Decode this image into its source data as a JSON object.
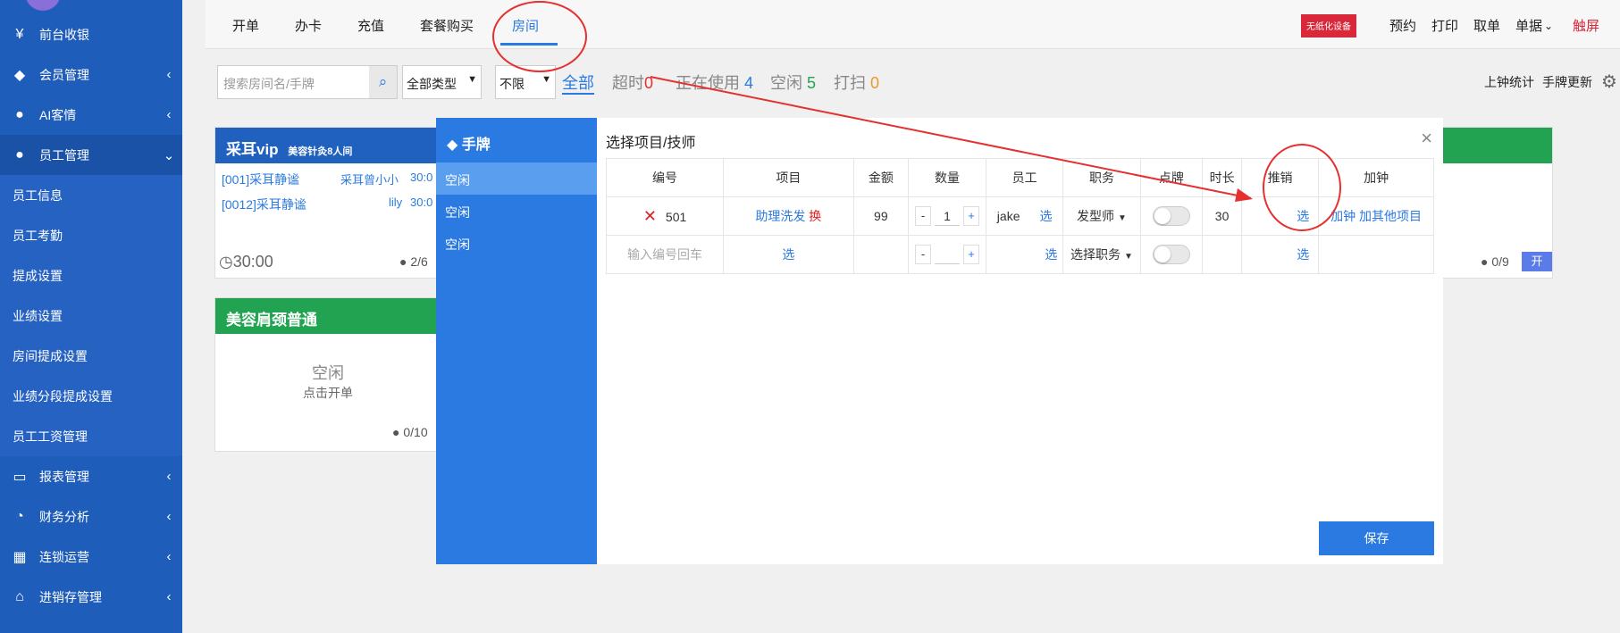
{
  "sidebar": {
    "items": [
      {
        "label": "前台收银",
        "icon": "yen-icon"
      },
      {
        "label": "会员管理",
        "icon": "diamond-icon",
        "chev": "‹"
      },
      {
        "label": "AI客情",
        "icon": "user-gear-icon",
        "chev": "‹"
      },
      {
        "label": "员工管理",
        "icon": "user-icon",
        "chev": "⌄"
      },
      {
        "label": "员工信息"
      },
      {
        "label": "员工考勤"
      },
      {
        "label": "提成设置"
      },
      {
        "label": "业绩设置"
      },
      {
        "label": "房间提成设置"
      },
      {
        "label": "业绩分段提成设置"
      },
      {
        "label": "员工工资管理"
      },
      {
        "label": "报表管理",
        "icon": "monitor-icon",
        "chev": "‹"
      },
      {
        "label": "财务分析",
        "icon": "pie-chart-icon",
        "chev": "‹"
      },
      {
        "label": "连锁运营",
        "icon": "building-icon",
        "chev": "‹"
      },
      {
        "label": "进销存管理",
        "icon": "home-icon",
        "chev": "‹"
      }
    ]
  },
  "topbar": {
    "tabs": [
      "开单",
      "办卡",
      "充值",
      "套餐购买",
      "房间"
    ],
    "device_badge": "无纸化设备",
    "right": [
      "预约",
      "打印",
      "取单",
      "单据",
      "触屏"
    ]
  },
  "filters": {
    "search_placeholder": "搜索房间名/手牌",
    "type_select": "全部类型",
    "limit_select": "不限",
    "status": {
      "all": "全部",
      "overtime": "超时",
      "overtime_count": "0",
      "in_use": "正在使用",
      "in_use_count": "4",
      "idle": "空闲",
      "idle_count": "5",
      "cleaning": "打扫",
      "cleaning_count": "0"
    },
    "right_links": [
      "上钟统计",
      "手牌更新"
    ]
  },
  "cards": {
    "card1": {
      "title": "采耳vip",
      "tag": "美容针灸8人间",
      "rows": [
        {
          "code": "[001]采耳静谧",
          "staff": "采耳曾小小",
          "time": "30:0"
        },
        {
          "code": "[0012]采耳静谧",
          "staff": "lily",
          "time": "30:0"
        }
      ],
      "timer": "30:00",
      "occupancy": "2/6"
    },
    "card2": {
      "title": "美容肩颈普通",
      "status": "空闲",
      "hint": "点击开单",
      "occupancy": "0/10"
    },
    "card3": {
      "occupancy": "0/9",
      "open_btn": "开"
    }
  },
  "modal": {
    "left_title": "手牌",
    "left_rows": [
      "空闲",
      "空闲",
      "空闲"
    ],
    "title": "选择项目/技师",
    "headers": [
      "编号",
      "项目",
      "金额",
      "数量",
      "员工",
      "职务",
      "点牌",
      "时长",
      "推销",
      "加钟"
    ],
    "row1": {
      "code": "501",
      "project": "助理洗发",
      "swap": "换",
      "amount": "99",
      "qty": "1",
      "minus": "-",
      "plus": "+",
      "staff": "jake",
      "pick": "选",
      "role": "发型师",
      "duration": "30",
      "promo": "选",
      "add_clock": "加钟",
      "add_other": "加其他项目"
    },
    "row2": {
      "code_placeholder": "输入编号回车",
      "project": "选",
      "minus": "-",
      "plus": "+",
      "pick": "选",
      "role": "选择职务",
      "promo": "选"
    },
    "save": "保存"
  },
  "colors": {
    "primary": "#2a7ae2",
    "sidebar": "#1f5dbb",
    "annotation": "#e53030",
    "green": "#22a352"
  }
}
